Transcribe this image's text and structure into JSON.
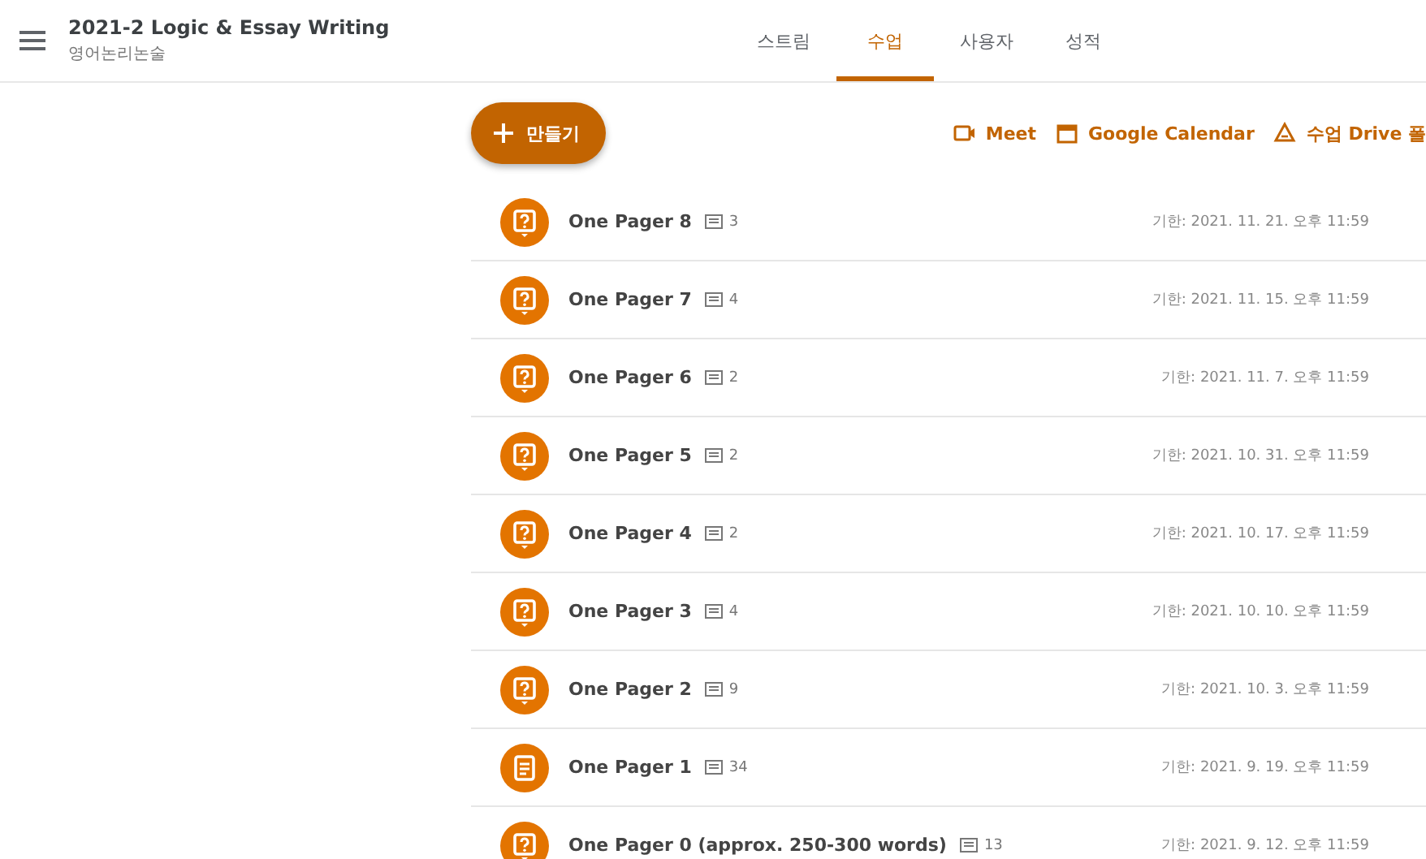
{
  "header": {
    "title": "2021-2 Logic & Essay Writing",
    "subtitle": "영어논리논술"
  },
  "tabs": [
    {
      "label": "스트림",
      "selected": false
    },
    {
      "label": "수업",
      "selected": true
    },
    {
      "label": "사용자",
      "selected": false
    },
    {
      "label": "성적",
      "selected": false
    }
  ],
  "create_button": {
    "label": "만들기"
  },
  "links": [
    {
      "kind": "meet",
      "label": "Meet"
    },
    {
      "kind": "calendar",
      "label": "Google Calendar"
    },
    {
      "kind": "drive",
      "label": "수업 Drive 폴"
    }
  ],
  "items": [
    {
      "kind": "question",
      "title": "One Pager 8",
      "comments": "3",
      "due": "기한: 2021. 11. 21. 오후 11:59"
    },
    {
      "kind": "question",
      "title": "One Pager 7",
      "comments": "4",
      "due": "기한: 2021. 11. 15. 오후 11:59"
    },
    {
      "kind": "question",
      "title": "One Pager 6",
      "comments": "2",
      "due": "기한: 2021. 11. 7. 오후 11:59"
    },
    {
      "kind": "question",
      "title": "One Pager 5",
      "comments": "2",
      "due": "기한: 2021. 10. 31. 오후 11:59"
    },
    {
      "kind": "question",
      "title": "One Pager 4",
      "comments": "2",
      "due": "기한: 2021. 10. 17. 오후 11:59"
    },
    {
      "kind": "question",
      "title": "One Pager 3",
      "comments": "4",
      "due": "기한: 2021. 10. 10. 오후 11:59"
    },
    {
      "kind": "question",
      "title": "One Pager 2",
      "comments": "9",
      "due": "기한: 2021. 10. 3. 오후 11:59"
    },
    {
      "kind": "assignment",
      "title": "One Pager 1",
      "comments": "34",
      "due": "기한: 2021. 9. 19. 오후 11:59"
    },
    {
      "kind": "question",
      "title": "One Pager 0 (approx. 250-300 words)",
      "comments": "13",
      "due": "기한: 2021. 9. 12. 오후 11:59"
    }
  ]
}
